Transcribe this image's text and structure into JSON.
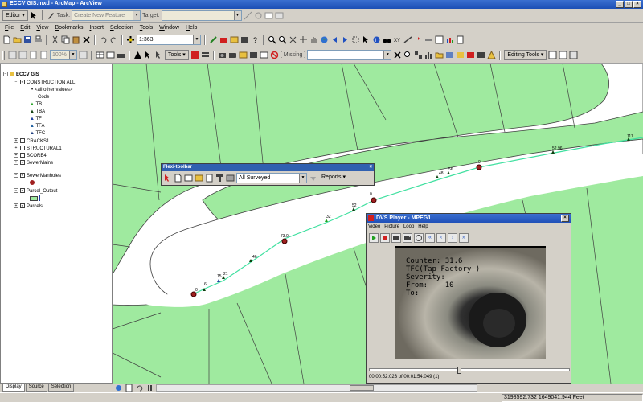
{
  "window": {
    "title": "ECCV GIS.mxd - ArcMap - ArcView"
  },
  "editor_toolbar": {
    "editor_label": "Editor",
    "task_label": "Task:",
    "task_value": "Create New Feature",
    "target_label": "Target:",
    "target_value": ""
  },
  "menu": [
    "File",
    "Edit",
    "View",
    "Bookmarks",
    "Insert",
    "Selection",
    "Tools",
    "Window",
    "Help"
  ],
  "standard_toolbar": {
    "scale": "1:363"
  },
  "tools_toolbar": {
    "zoom_pct": "100%",
    "tools_label": "Tools",
    "missing_label": "[ Missing ]",
    "editing_tools_label": "Editing Tools"
  },
  "toc": {
    "root": "ECCV GIS",
    "layers": [
      {
        "name": "CONSTRUCTION ALL",
        "checked": true,
        "expanded": true
      },
      {
        "name": "<all other values>",
        "legend": true
      },
      {
        "name": "Code",
        "legend": true
      },
      {
        "name": "TB",
        "legend": true
      },
      {
        "name": "TBA",
        "legend": true
      },
      {
        "name": "TF",
        "legend": true
      },
      {
        "name": "TFA",
        "legend": true
      },
      {
        "name": "TFC",
        "legend": true
      },
      {
        "name": "CRACKS1",
        "checked": false,
        "expanded": false
      },
      {
        "name": "STRUCTURAL1",
        "checked": false,
        "expanded": false
      },
      {
        "name": "SCORE4",
        "checked": false,
        "expanded": false
      },
      {
        "name": "SewerMains",
        "checked": true,
        "expanded": false
      },
      {
        "name": "SewerManholes",
        "checked": true,
        "expanded": true
      },
      {
        "name": "Parcel_Output",
        "checked": true,
        "expanded": true
      },
      {
        "name": "Parcels",
        "checked": true,
        "expanded": false
      }
    ],
    "tabs": [
      "Display",
      "Source",
      "Selection"
    ]
  },
  "flexi_toolbar": {
    "title": "Flexi-toolbar",
    "dropdown": "All Surveyed",
    "reports_label": "Reports"
  },
  "dvs_player": {
    "title": "DVS Player - MPEG1",
    "menu": [
      "Video",
      "Picture",
      "Loop",
      "Help"
    ],
    "overlay": {
      "counter": "Counter: 31.6",
      "code": "TFC(Tap Factory )",
      "severity": "Severity:",
      "from": "From:    10",
      "to": "To:"
    },
    "timecode": "00:00:52:023 of 00:01:54:049 (1)",
    "progress": 0.45
  },
  "map": {
    "point_labels": [
      "0",
      "6",
      "15",
      "21",
      "46",
      "73.0",
      "32",
      "52",
      "0",
      "48",
      "56",
      "0",
      "52.96",
      "111"
    ]
  },
  "status": {
    "coordinates": "3198592.732  1649041.944 Feet"
  },
  "colors": {
    "parcel_fill": "#9fea9f",
    "road_fill": "#ffffff",
    "sewer_line": "#40e0a0",
    "manhole": "#a02020"
  }
}
